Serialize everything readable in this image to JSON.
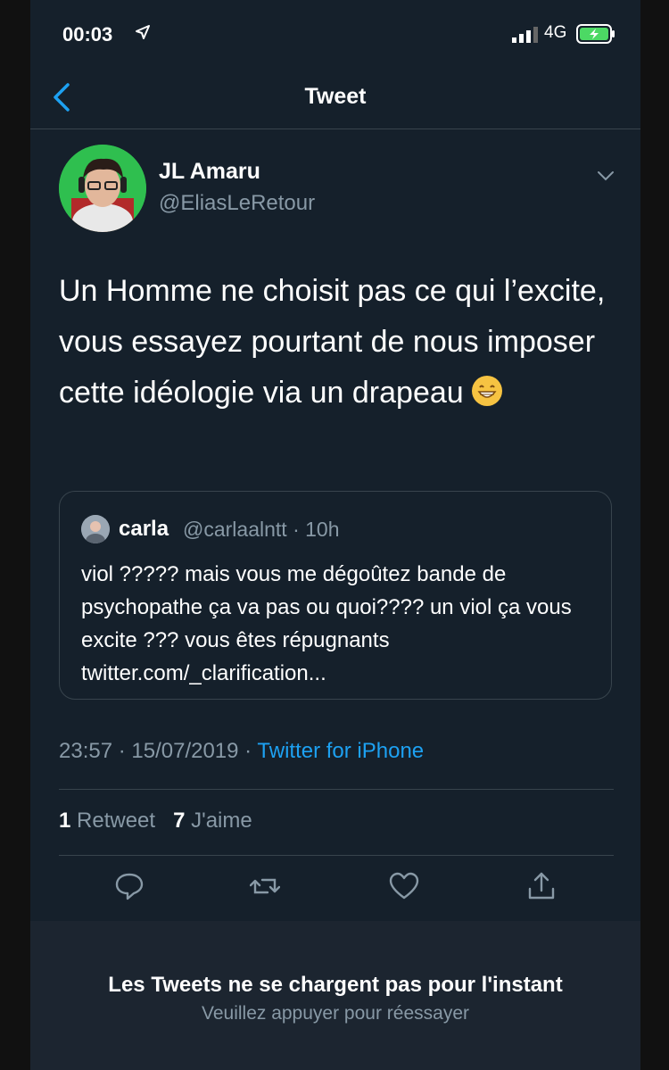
{
  "status_bar": {
    "time": "00:03",
    "network": "4G"
  },
  "nav": {
    "title": "Tweet"
  },
  "tweet": {
    "display_name": "JL Amaru",
    "handle": "@EliasLeRetour",
    "text": "Un Homme ne choisit pas ce qui l’excite, vous essayez pourtant de nous imposer cette idéologie via un drapeau",
    "emoji": "grinning-face-icon"
  },
  "quote": {
    "name": "carla",
    "handle": "@carlaalntt · 10h",
    "text": "viol ????? mais vous me dégoûtez bande de psychopathe ça va pas ou quoi???? un viol ça vous excite ??? vous êtes répugnants twitter.com/_clarification..."
  },
  "meta": {
    "datetime": "23:57 · 15/07/2019 · ",
    "source": "Twitter for iPhone"
  },
  "stats": {
    "retweets_count": "1",
    "retweets_label": "Retweet",
    "likes_count": "7",
    "likes_label": "J'aime"
  },
  "actions": [
    "reply-icon",
    "retweet-icon",
    "like-icon",
    "share-icon"
  ],
  "banner": {
    "title": "Les Tweets ne se chargent pas pour l'instant",
    "subtitle": "Veuillez appuyer pour réessayer"
  },
  "colors": {
    "background": "#15202b",
    "accent": "#1da1f2",
    "muted": "#8899a6",
    "battery": "#4cd964"
  }
}
